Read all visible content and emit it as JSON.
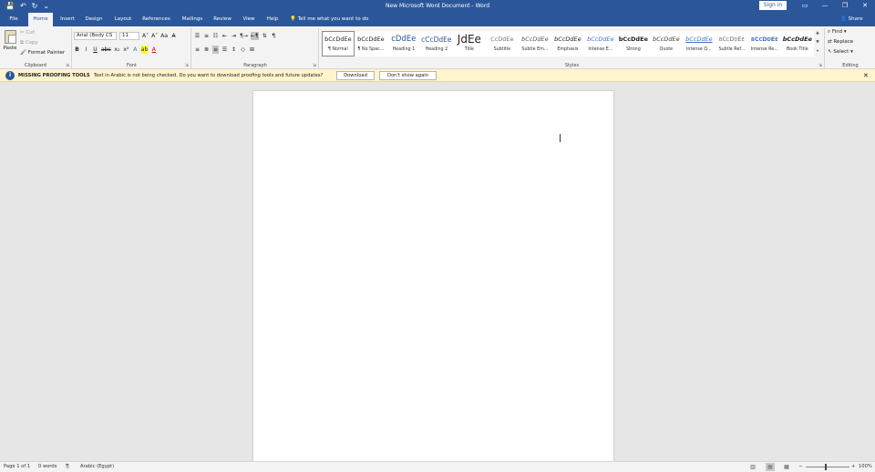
{
  "titlebar": {
    "title": "New Microsoft Word Document  -  Word",
    "sign_in": "Sign in",
    "qat": [
      "💾",
      "↶",
      "↻",
      "⌄"
    ],
    "window_buttons": [
      "▭",
      "—",
      "❐",
      "✕"
    ]
  },
  "tabs": [
    {
      "label": "File",
      "active": false
    },
    {
      "label": "Home",
      "active": true
    },
    {
      "label": "Insert",
      "active": false
    },
    {
      "label": "Design",
      "active": false
    },
    {
      "label": "Layout",
      "active": false
    },
    {
      "label": "References",
      "active": false
    },
    {
      "label": "Mailings",
      "active": false
    },
    {
      "label": "Review",
      "active": false
    },
    {
      "label": "View",
      "active": false
    },
    {
      "label": "Help",
      "active": false
    }
  ],
  "tell_me": "Tell me what you want to do",
  "share": "Share",
  "clipboard": {
    "paste": "Paste",
    "cut": "Cut",
    "copy": "Copy",
    "format_painter": "Format Painter",
    "label": "Clipboard"
  },
  "font": {
    "name": "Arial (Body CS",
    "size": "11",
    "grow": "A˄",
    "shrink": "A˅",
    "change_case": "Aa",
    "clear": "A̶",
    "bold": "B",
    "italic": "I",
    "underline": "U",
    "strikethrough": "abc",
    "subscript": "x₂",
    "superscript": "x²",
    "text_effects": "A",
    "highlight": "ab",
    "font_color": "A",
    "label": "Font"
  },
  "paragraph": {
    "label": "Paragraph",
    "pilcrow": "¶"
  },
  "styles": {
    "label": "Styles",
    "items": [
      {
        "preview": "bCcDdEe",
        "name": "¶ Normal",
        "selected": true
      },
      {
        "preview": "bCcDdEe",
        "name": "¶ No Spac...",
        "selected": false
      },
      {
        "preview": "cDdEe",
        "name": "Heading 1",
        "selected": false
      },
      {
        "preview": "cCcDdEe",
        "name": "Heading 2",
        "selected": false
      },
      {
        "preview": "JdEe",
        "name": "Title",
        "selected": false
      },
      {
        "preview": "CcDdEe",
        "name": "Subtitle",
        "selected": false
      },
      {
        "preview": "bCcDdEe",
        "name": "Subtle Em...",
        "selected": false
      },
      {
        "preview": "bCcDdEe",
        "name": "Emphasis",
        "selected": false
      },
      {
        "preview": "bCcDdEe",
        "name": "Intense E...",
        "selected": false
      },
      {
        "preview": "bCcDdEe",
        "name": "Strong",
        "selected": false
      },
      {
        "preview": "bCcDdEe",
        "name": "Quote",
        "selected": false
      },
      {
        "preview": "bCcDdEe",
        "name": "Intense Q...",
        "selected": false
      },
      {
        "preview": "bCcDdEe",
        "name": "Subtle Ref...",
        "selected": false
      },
      {
        "preview": "bCcDdEe",
        "name": "Intense Re...",
        "selected": false
      },
      {
        "preview": "bCcDdEe",
        "name": "Book Title",
        "selected": false
      }
    ]
  },
  "editing": {
    "find": "Find",
    "replace": "Replace",
    "select": "Select",
    "label": "Editing"
  },
  "message_bar": {
    "title": "MISSING PROOFING TOOLS",
    "text": "Text in Arabic is not being checked. Do you want to download proofing tools and future updates?",
    "download": "Download",
    "dont_show": "Don't show again",
    "close": "✕"
  },
  "status": {
    "page": "Page 1 of 1",
    "words": "0 words",
    "language": "Arabic (Egypt)",
    "zoom": "100%",
    "zoom_minus": "−",
    "zoom_plus": "+"
  },
  "colors": {
    "accent": "#2b579a",
    "ribbon_bg": "#f3f3f3",
    "message_bg": "#fff4ce",
    "canvas_bg": "#e6e6e6"
  }
}
